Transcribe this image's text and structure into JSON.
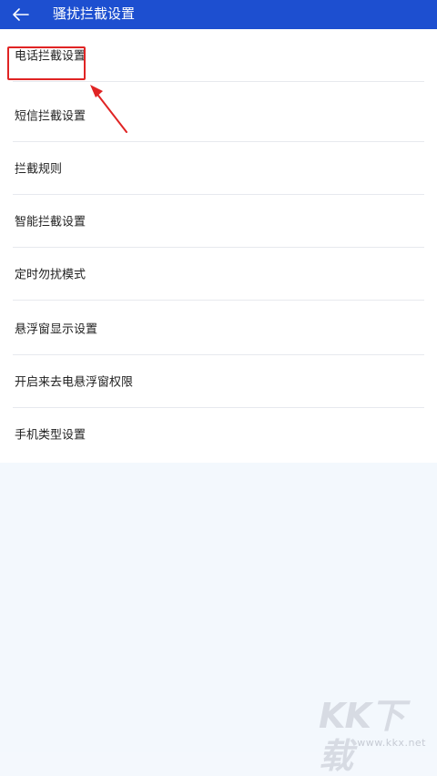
{
  "header": {
    "title": "骚扰拦截设置",
    "back_icon": "arrow-left-icon"
  },
  "colors": {
    "header_bg": "#1d4fd0",
    "highlight": "#e02424"
  },
  "settings": {
    "items": [
      {
        "label": "电话拦截设置"
      },
      {
        "label": "短信拦截设置"
      },
      {
        "label": "拦截规则"
      },
      {
        "label": "智能拦截设置"
      },
      {
        "label": "定时勿扰模式"
      },
      {
        "label": "悬浮窗显示设置"
      },
      {
        "label": "开启来去电悬浮窗权限"
      },
      {
        "label": "手机类型设置"
      }
    ]
  },
  "watermark": {
    "logo": "KK下载",
    "url": "www.kkx.net"
  }
}
